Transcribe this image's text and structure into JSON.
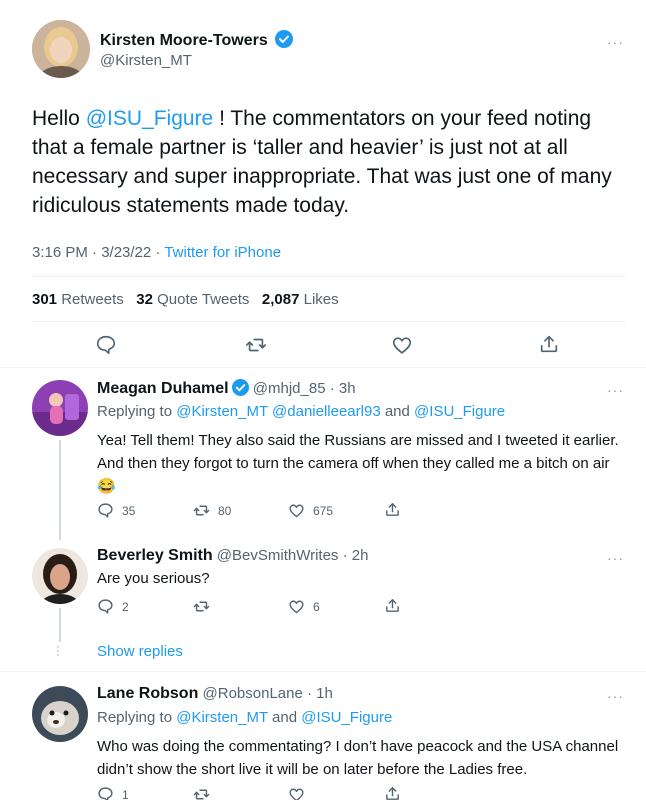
{
  "main_tweet": {
    "author_name": "Kirsten Moore-Towers",
    "handle": "@Kirsten_MT",
    "text_prefix": "Hello ",
    "mention": "@ISU_Figure",
    "text_rest": " ! The commentators on your feed noting that a female partner is ‘taller and heavier’ is just not at all necessary and super inappropriate. That was just one of many ridiculous statements made today.",
    "time": "3:16 PM · 3/23/22 · ",
    "source": "Twitter for iPhone",
    "retweets_count": "301",
    "retweets_label": "Retweets",
    "quotes_count": "32",
    "quotes_label": "Quote Tweets",
    "likes_count": "2,087",
    "likes_label": "Likes",
    "more": "···"
  },
  "replies": [
    {
      "author_name": "Meagan Duhamel",
      "meta": "@mhjd_85 · 3h",
      "replying_to_label": "Replying to ",
      "replying_to_a": "@Kirsten_MT",
      "replying_to_b": "@danielleearl93",
      "replying_and": " and ",
      "replying_to_c": "@ISU_Figure",
      "text": "Yea! Tell them! They also said the Russians are missed and I tweeted it earlier. And then they forgot to turn the camera off when they called me a bitch on air 😂",
      "reply_count": "35",
      "retweet_count": "80",
      "like_count": "675",
      "more": "···"
    },
    {
      "author_name": "Beverley Smith",
      "meta": "@BevSmithWrites · 2h",
      "text": "Are you serious?",
      "reply_count": "2",
      "retweet_count": "",
      "like_count": "6",
      "more": "···"
    },
    {
      "author_name": "Lane Robson",
      "meta": "@RobsonLane · 1h",
      "replying_to_label": "Replying to ",
      "replying_to_a": "@Kirsten_MT",
      "replying_and": " and ",
      "replying_to_b": "@ISU_Figure",
      "text": "Who was doing the commentating? I don’t have peacock and the USA channel didn’t show the short live it will be on later before the Ladies free.",
      "reply_count": "1",
      "more": "···"
    }
  ],
  "show_replies": "Show replies",
  "colors": {
    "accent": "#1d9bf0",
    "muted": "#536471",
    "divider": "#eff3f4"
  }
}
